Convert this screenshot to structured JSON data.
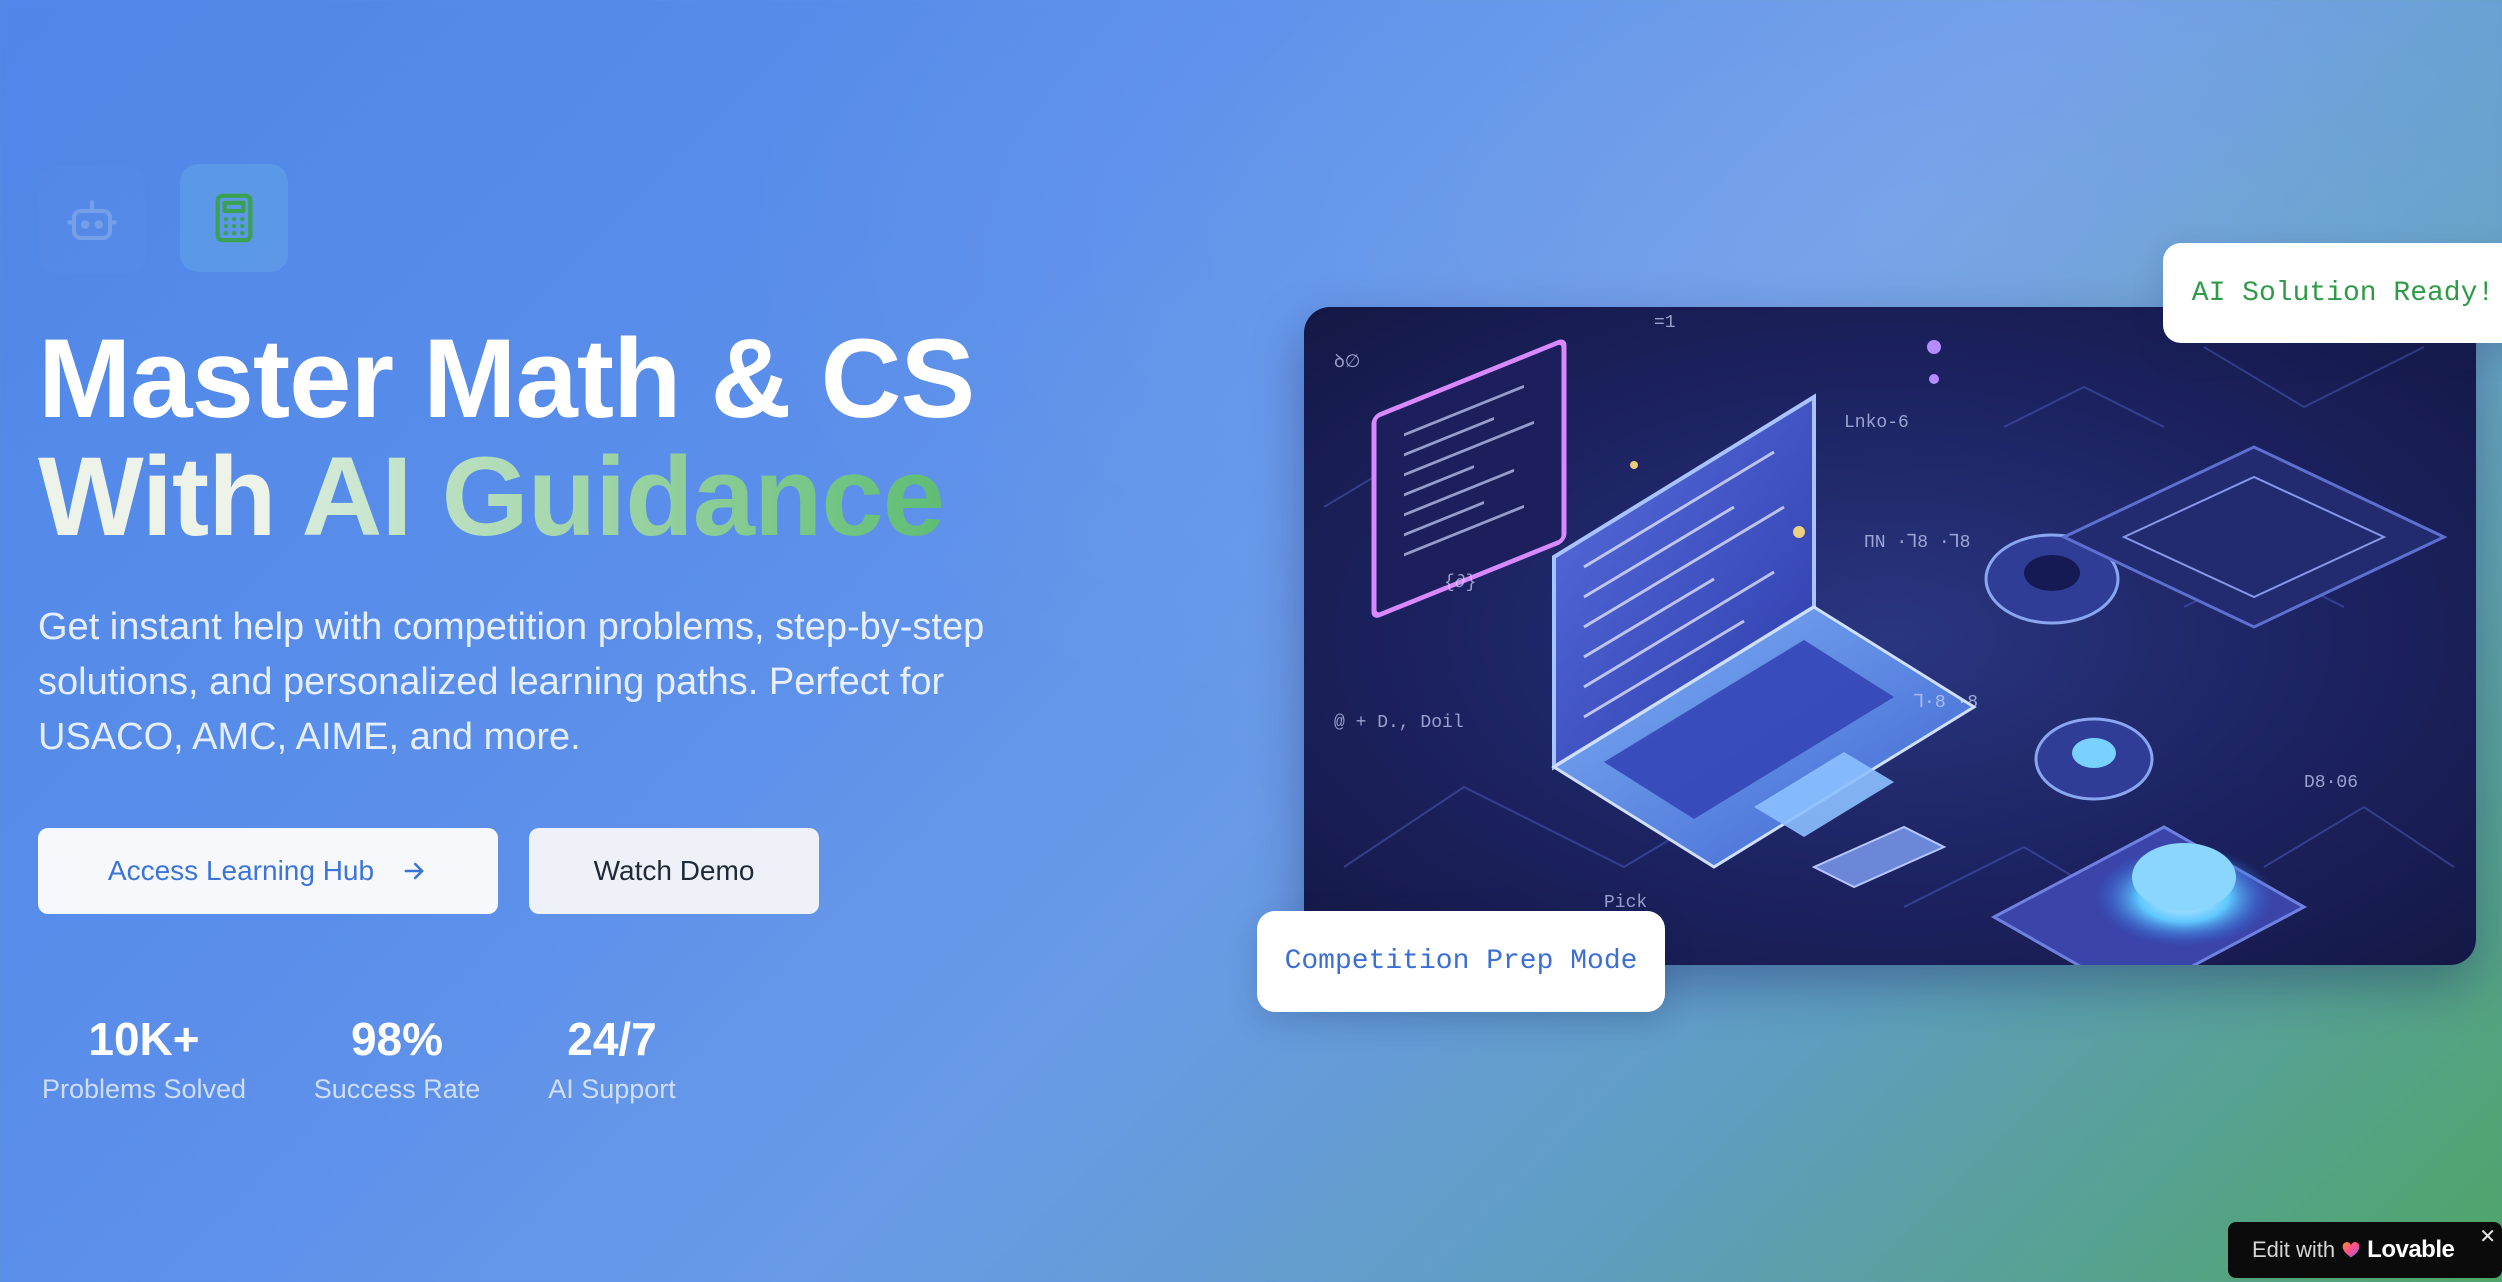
{
  "hero": {
    "headline_line1": "Master Math & CS",
    "headline_line2_prefix": "With",
    "headline_line2_accent": "AI Guidance",
    "subtitle": "Get instant help with competition problems, step-by-step solutions, and personalized learning paths. Perfect for USACO, AMC, AIME, and more."
  },
  "buttons": {
    "primary_label": "Access Learning Hub",
    "secondary_label": "Watch Demo"
  },
  "stats": [
    {
      "value": "10K+",
      "label": "Problems Solved"
    },
    {
      "value": "98%",
      "label": "Success Rate"
    },
    {
      "value": "24/7",
      "label": "AI Support"
    }
  ],
  "badges": {
    "ai_solution": "AI Solution Ready!",
    "competition": "Competition Prep Mode"
  },
  "lovable": {
    "edit_text": "Edit with",
    "brand": "Lovable",
    "close": "✕"
  },
  "icons": [
    "robot-icon",
    "calculator-icon",
    "arrow-right-icon",
    "lovable-heart-icon",
    "close-icon"
  ],
  "colors": {
    "primary_blue": "#4f86e8",
    "accent_green": "#5fbd73",
    "badge_green_text": "#2f9a48",
    "badge_blue_text": "#3b6fd6"
  }
}
